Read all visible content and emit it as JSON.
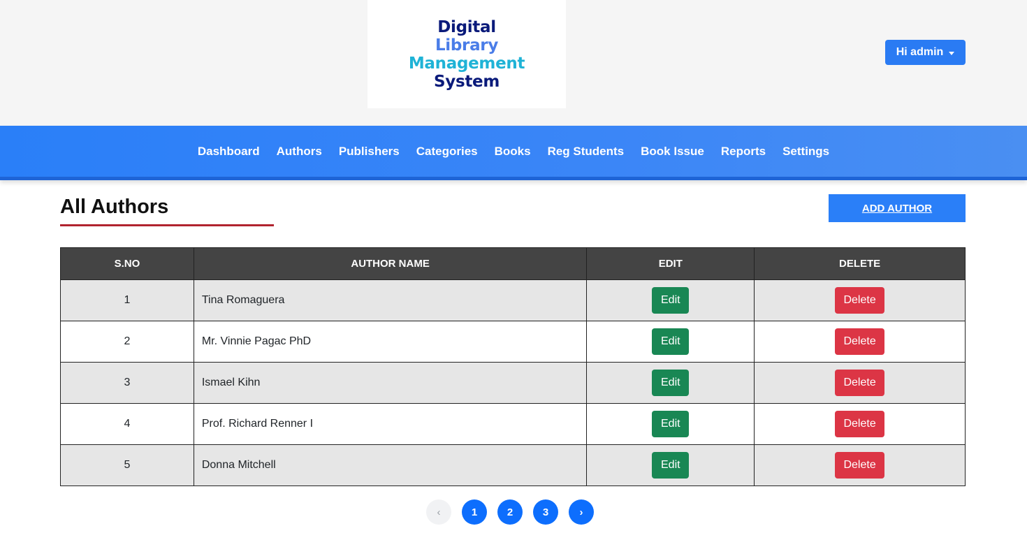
{
  "header": {
    "logo": {
      "line1": "Digital",
      "line2": "Library",
      "line3": "Management",
      "line4": "System"
    },
    "user_menu_label": "Hi admin"
  },
  "nav": {
    "items": [
      {
        "label": "Dashboard"
      },
      {
        "label": "Authors"
      },
      {
        "label": "Publishers"
      },
      {
        "label": "Categories"
      },
      {
        "label": "Books"
      },
      {
        "label": "Reg Students"
      },
      {
        "label": "Book Issue"
      },
      {
        "label": "Reports"
      },
      {
        "label": "Settings"
      }
    ]
  },
  "main": {
    "title": "All Authors",
    "add_button_label": "ADD AUTHOR",
    "table": {
      "headers": [
        "S.NO",
        "AUTHOR NAME",
        "EDIT",
        "DELETE"
      ],
      "rows": [
        {
          "sno": "1",
          "name": "Tina Romaguera",
          "edit": "Edit",
          "delete": "Delete"
        },
        {
          "sno": "2",
          "name": "Mr. Vinnie Pagac PhD",
          "edit": "Edit",
          "delete": "Delete"
        },
        {
          "sno": "3",
          "name": "Ismael Kihn",
          "edit": "Edit",
          "delete": "Delete"
        },
        {
          "sno": "4",
          "name": "Prof. Richard Renner I",
          "edit": "Edit",
          "delete": "Delete"
        },
        {
          "sno": "5",
          "name": "Donna Mitchell",
          "edit": "Edit",
          "delete": "Delete"
        }
      ]
    },
    "pagination": {
      "prev": "‹",
      "pages": [
        "1",
        "2",
        "3"
      ],
      "next": "›",
      "current": "1"
    }
  },
  "colors": {
    "primary": "#2a7ff8",
    "nav_border": "#1e64d6",
    "title_underline": "#b1232f",
    "table_header": "#444444",
    "edit_button": "#198754",
    "delete_button": "#dc3545",
    "page_button": "#0d6efd"
  },
  "icons": {
    "user_menu": "caret-down-icon"
  }
}
